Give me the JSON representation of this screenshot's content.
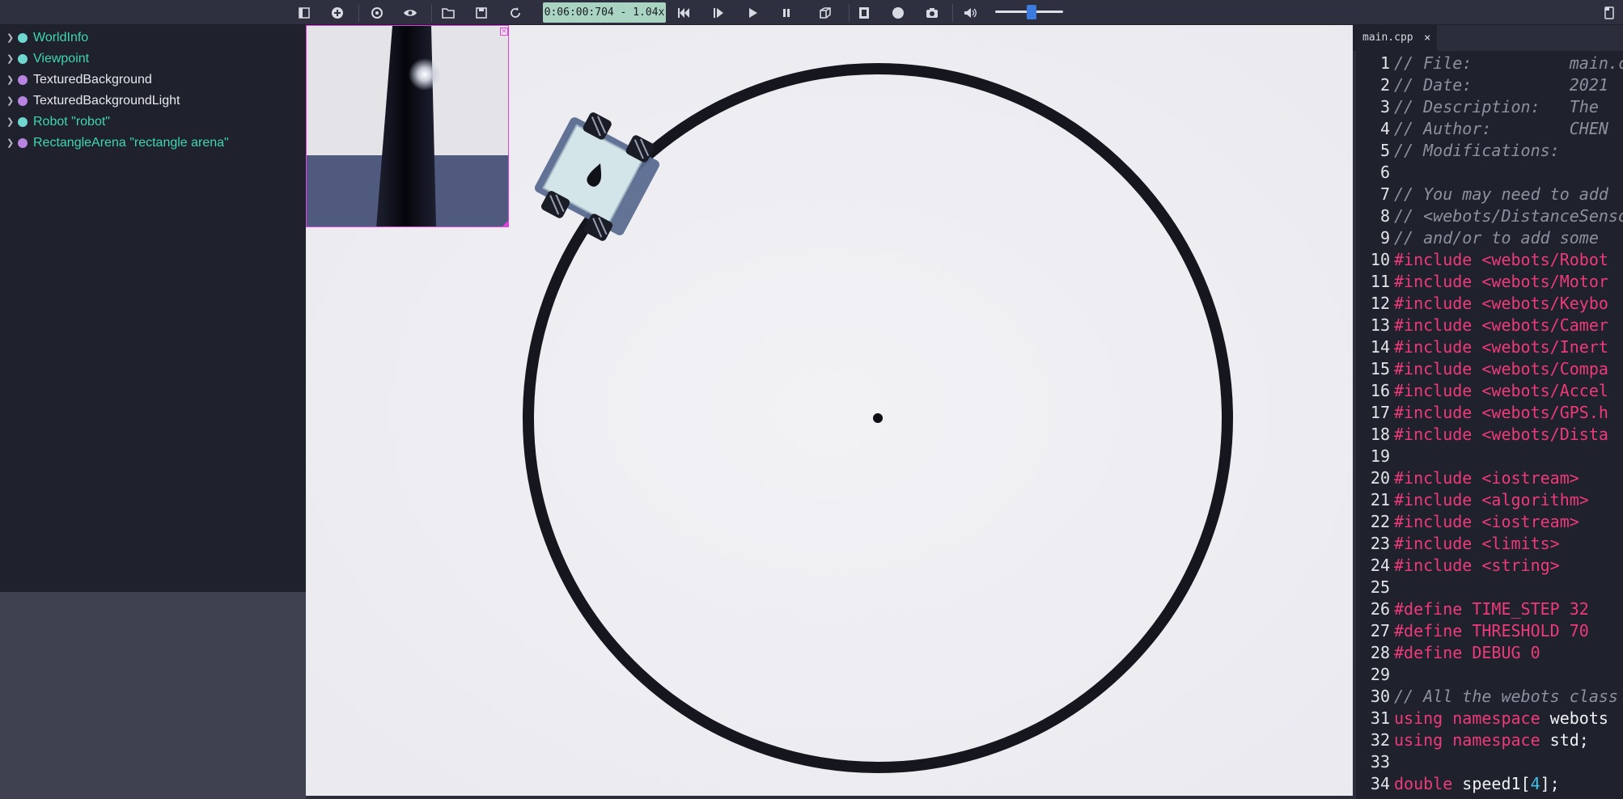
{
  "toolbar": {
    "buttons": [
      {
        "name": "toggle-scene-tree",
        "icon": "panel-icon"
      },
      {
        "name": "add-node",
        "icon": "plus-circle-icon"
      },
      {
        "name": "reset-view",
        "icon": "rotate-icon"
      },
      {
        "name": "view-options",
        "icon": "eye-icon"
      },
      {
        "name": "open-world",
        "icon": "folder-icon"
      },
      {
        "name": "save-world",
        "icon": "save-icon"
      },
      {
        "name": "reload-world",
        "icon": "reload-icon"
      },
      {
        "name": "reset-simulation",
        "icon": "skip-back-icon"
      },
      {
        "name": "step",
        "icon": "step-icon"
      },
      {
        "name": "run",
        "icon": "play-icon"
      },
      {
        "name": "pause",
        "icon": "pause-icon"
      },
      {
        "name": "fast",
        "icon": "cube-icon"
      },
      {
        "name": "record-movie",
        "icon": "film-icon"
      },
      {
        "name": "record-animation",
        "icon": "record-icon"
      },
      {
        "name": "screenshot",
        "icon": "camera-icon"
      },
      {
        "name": "sound",
        "icon": "speaker-icon"
      }
    ],
    "simulation_time": "0:06:00:704  -  1.04x",
    "volume_level": 0.53
  },
  "scene_tree": {
    "nodes": [
      {
        "label": "WorldInfo",
        "color": "#3fd6b0",
        "dot": "#6fd6d0"
      },
      {
        "label": "Viewpoint",
        "color": "#3fd6b0",
        "dot": "#6fd6d0"
      },
      {
        "label": "TexturedBackground",
        "color": "#e8e9ef",
        "dot": "#b884e0"
      },
      {
        "label": "TexturedBackgroundLight",
        "color": "#e8e9ef",
        "dot": "#b884e0"
      },
      {
        "label": "Robot \"robot\"",
        "color": "#3fd6b0",
        "dot": "#6fd6d0"
      },
      {
        "label": "RectangleArena \"rectangle arena\"",
        "color": "#3fd6b0",
        "dot": "#b884e0"
      }
    ]
  },
  "viewport": {
    "camera_close_label": "×"
  },
  "editor": {
    "tab_label": "main.cpp",
    "tab_close": "×",
    "lines": [
      {
        "n": "1",
        "t": [
          [
            "comment",
            "// File:          main.cpp"
          ]
        ]
      },
      {
        "n": "2",
        "t": [
          [
            "comment",
            "// Date:          2021"
          ]
        ]
      },
      {
        "n": "3",
        "t": [
          [
            "comment",
            "// Description:   The"
          ]
        ]
      },
      {
        "n": "4",
        "t": [
          [
            "comment",
            "// Author:        CHEN"
          ]
        ]
      },
      {
        "n": "5",
        "t": [
          [
            "comment",
            "// Modifications:"
          ]
        ]
      },
      {
        "n": "6",
        "t": []
      },
      {
        "n": "7",
        "t": [
          [
            "comment",
            "// You may need to add"
          ]
        ]
      },
      {
        "n": "8",
        "t": [
          [
            "comment",
            "// <webots/DistanceSensor"
          ]
        ]
      },
      {
        "n": "9",
        "t": [
          [
            "comment",
            "// and/or to add some"
          ]
        ]
      },
      {
        "n": "10",
        "t": [
          [
            "directive",
            "#include <webots/Robot"
          ]
        ]
      },
      {
        "n": "11",
        "t": [
          [
            "directive",
            "#include <webots/Motor"
          ]
        ]
      },
      {
        "n": "12",
        "t": [
          [
            "directive",
            "#include <webots/Keybo"
          ]
        ]
      },
      {
        "n": "13",
        "t": [
          [
            "directive",
            "#include <webots/Camer"
          ]
        ]
      },
      {
        "n": "14",
        "t": [
          [
            "directive",
            "#include <webots/Inert"
          ]
        ]
      },
      {
        "n": "15",
        "t": [
          [
            "directive",
            "#include <webots/Compa"
          ]
        ]
      },
      {
        "n": "16",
        "t": [
          [
            "directive",
            "#include <webots/Accel"
          ]
        ]
      },
      {
        "n": "17",
        "t": [
          [
            "directive",
            "#include <webots/GPS.h"
          ]
        ]
      },
      {
        "n": "18",
        "t": [
          [
            "directive",
            "#include <webots/Dista"
          ]
        ]
      },
      {
        "n": "19",
        "t": []
      },
      {
        "n": "20",
        "t": [
          [
            "directive",
            "#include <iostream>"
          ]
        ]
      },
      {
        "n": "21",
        "t": [
          [
            "directive",
            "#include <algorithm>"
          ]
        ]
      },
      {
        "n": "22",
        "t": [
          [
            "directive",
            "#include <iostream>"
          ]
        ]
      },
      {
        "n": "23",
        "t": [
          [
            "directive",
            "#include <limits>"
          ]
        ]
      },
      {
        "n": "24",
        "t": [
          [
            "directive",
            "#include <string>"
          ]
        ]
      },
      {
        "n": "25",
        "t": []
      },
      {
        "n": "26",
        "t": [
          [
            "directive",
            "#define TIME_STEP 32"
          ]
        ]
      },
      {
        "n": "27",
        "t": [
          [
            "directive",
            "#define THRESHOLD 70"
          ]
        ]
      },
      {
        "n": "28",
        "t": [
          [
            "directive",
            "#define DEBUG 0"
          ]
        ]
      },
      {
        "n": "29",
        "t": []
      },
      {
        "n": "30",
        "t": [
          [
            "comment",
            "// All the webots class"
          ]
        ]
      },
      {
        "n": "31",
        "t": [
          [
            "keyword",
            "using namespace "
          ],
          [
            "plain",
            "webots"
          ]
        ]
      },
      {
        "n": "32",
        "t": [
          [
            "keyword",
            "using namespace "
          ],
          [
            "plain",
            "std;"
          ]
        ]
      },
      {
        "n": "33",
        "t": []
      },
      {
        "n": "34",
        "t": [
          [
            "keyword",
            "double "
          ],
          [
            "plain",
            "speed1["
          ],
          [
            "number",
            "4"
          ],
          [
            "plain",
            "];"
          ]
        ]
      }
    ]
  }
}
